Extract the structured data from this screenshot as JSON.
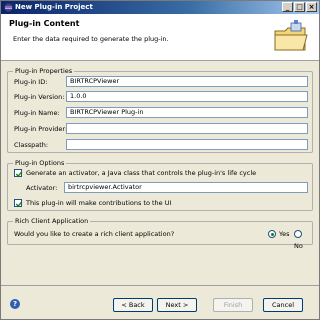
{
  "window": {
    "title": "New Plug-in Project"
  },
  "header": {
    "title": "Plug-in Content",
    "description": "Enter the data required to generate the plug-in."
  },
  "properties": {
    "legend": "Plug-in Properties",
    "fields": [
      {
        "label": "Plug-in ID:",
        "value": "BIRTRCPViewer"
      },
      {
        "label": "Plug-in Version:",
        "value": "1.0.0"
      },
      {
        "label": "Plug-in Name:",
        "value": "BIRTRCPViewer Plug-in"
      },
      {
        "label": "Plug-in Provider:",
        "value": ""
      },
      {
        "label": "Classpath:",
        "value": ""
      }
    ]
  },
  "options": {
    "legend": "Plug-in Options",
    "generate_activator": {
      "label": "Generate an activator, a Java class that controls the plug-in's life cycle",
      "checked": true
    },
    "activator": {
      "label": "Activator:",
      "value": "birtrcpviewer.Activator"
    },
    "ui_contrib": {
      "label": "This plug-in will make contributions to the UI",
      "checked": true
    }
  },
  "rcp": {
    "legend": "Rich Client Application",
    "question": "Would you like to create a rich client application?",
    "yes": "Yes",
    "no": "No",
    "selected": "Yes"
  },
  "buttons": {
    "help": "?",
    "back": "< Back",
    "next": "Next >",
    "finish": "Finish",
    "cancel": "Cancel"
  }
}
